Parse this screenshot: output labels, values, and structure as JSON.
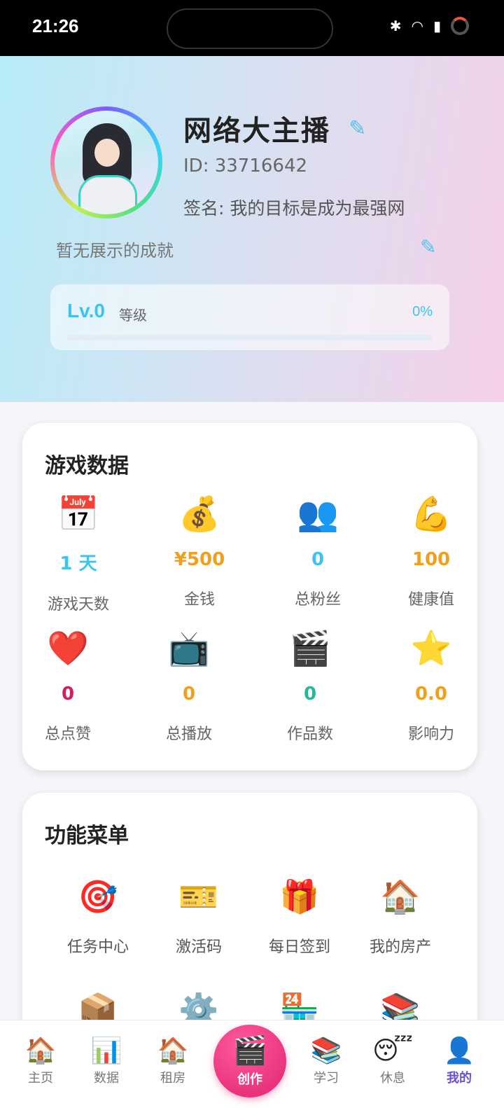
{
  "status_bar": {
    "time": "21:26",
    "icons": [
      "bluetooth-icon",
      "wifi-icon",
      "5g-signal-icon",
      "battery-ring-icon"
    ]
  },
  "profile": {
    "name": "网络大主播",
    "id": "ID: 33716642",
    "signature": "签名: 我的目标是成为最强网",
    "achievement": "暂无展示的成就",
    "level": "Lv.0",
    "level_label": "等级",
    "level_percent_text": "0%",
    "level_progress": 0
  },
  "stats": {
    "title": "游戏数据",
    "items": [
      {
        "icon": "📅",
        "value": "1 天",
        "label": "游戏天数",
        "color": "#3ec3ee"
      },
      {
        "icon": "💰",
        "value": "¥500",
        "label": "金钱",
        "color": "#f0a020"
      },
      {
        "icon": "👥",
        "value": "0",
        "label": "总粉丝",
        "color": "#3ec3ee"
      },
      {
        "icon": "💪",
        "value": "100",
        "label": "健康值",
        "color": "#f0a020"
      },
      {
        "icon": "❤️",
        "value": "0",
        "label": "总点赞",
        "color": "#d01f5c"
      },
      {
        "icon": "📺",
        "value": "0",
        "label": "总播放",
        "color": "#f0a020"
      },
      {
        "icon": "🎬",
        "value": "0",
        "label": "作品数",
        "color": "#2ab59a"
      },
      {
        "icon": "⭐",
        "value": "0.0",
        "label": "影响力",
        "color": "#f0a020"
      }
    ]
  },
  "menu": {
    "title": "功能菜单",
    "items": [
      {
        "icon": "🎯",
        "label": "任务中心"
      },
      {
        "icon": "🎫",
        "label": "激活码"
      },
      {
        "icon": "🎁",
        "label": "每日签到"
      },
      {
        "icon": "🏠",
        "label": "我的房产"
      },
      {
        "icon": "📦",
        "label": ""
      },
      {
        "icon": "⚙️",
        "label": ""
      },
      {
        "icon": "🏪",
        "label": ""
      },
      {
        "icon": "📚",
        "label": ""
      }
    ]
  },
  "nav": {
    "items": [
      {
        "icon": "🏠",
        "label": "主页"
      },
      {
        "icon": "📊",
        "label": "数据"
      },
      {
        "icon": "🏠",
        "label": "租房"
      },
      {
        "icon": "🎬",
        "label": "创作"
      },
      {
        "icon": "📚",
        "label": "学习"
      },
      {
        "icon": "😴",
        "label": "休息"
      },
      {
        "icon": "👤",
        "label": "我的"
      }
    ],
    "active": "我的"
  }
}
